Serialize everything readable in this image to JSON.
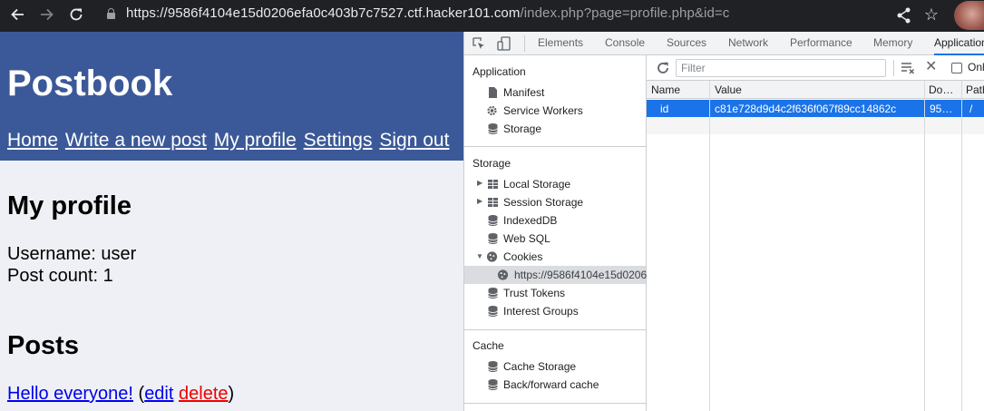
{
  "browser": {
    "url_host": "https://9586f4104e15d0206efa0c403b7c7527.ctf.hacker101.com",
    "url_path": "/index.php?page=profile.php&id=c",
    "back_icon": "arrow-back-icon",
    "forward_icon": "arrow-forward-icon",
    "reload_icon": "reload-icon"
  },
  "site": {
    "title": "Postbook",
    "nav": [
      "Home",
      "Write a new post",
      "My profile",
      "Settings",
      "Sign out"
    ],
    "profile_heading": "My profile",
    "username_line": "Username: user",
    "post_count_line": "Post count: 1",
    "posts_heading": "Posts",
    "post_title": "Hello everyone!",
    "edit_label": "edit",
    "delete_label": "delete",
    "open_paren": " (",
    "space": " ",
    "close_paren": ")"
  },
  "devtools": {
    "tabs": [
      "Elements",
      "Console",
      "Sources",
      "Network",
      "Performance",
      "Memory",
      "Application"
    ],
    "active_tab": "Application",
    "sidebar": {
      "application_title": "Application",
      "application_items": [
        "Manifest",
        "Service Workers",
        "Storage"
      ],
      "storage_title": "Storage",
      "storage_items": [
        "Local Storage",
        "Session Storage",
        "IndexedDB",
        "Web SQL",
        "Cookies"
      ],
      "cookie_origin": "https://9586f4104e15d0206",
      "storage_items_after": [
        "Trust Tokens",
        "Interest Groups"
      ],
      "cache_title": "Cache",
      "cache_items": [
        "Cache Storage",
        "Back/forward cache"
      ]
    },
    "toolbar": {
      "filter_placeholder": "Filter",
      "only_label": "Onl"
    },
    "cookies_table": {
      "columns": [
        "Name",
        "Value",
        "Do…",
        "Path"
      ],
      "rows": [
        {
          "name": "id",
          "value": "c81e728d9d4c2f636f067f89cc14862c",
          "domain": "95…",
          "path": "/"
        }
      ]
    }
  },
  "colors": {
    "site_header": "#3b5998",
    "selection": "#1a73e8",
    "delete_link": "#ee0000",
    "link": "#0000ee"
  }
}
